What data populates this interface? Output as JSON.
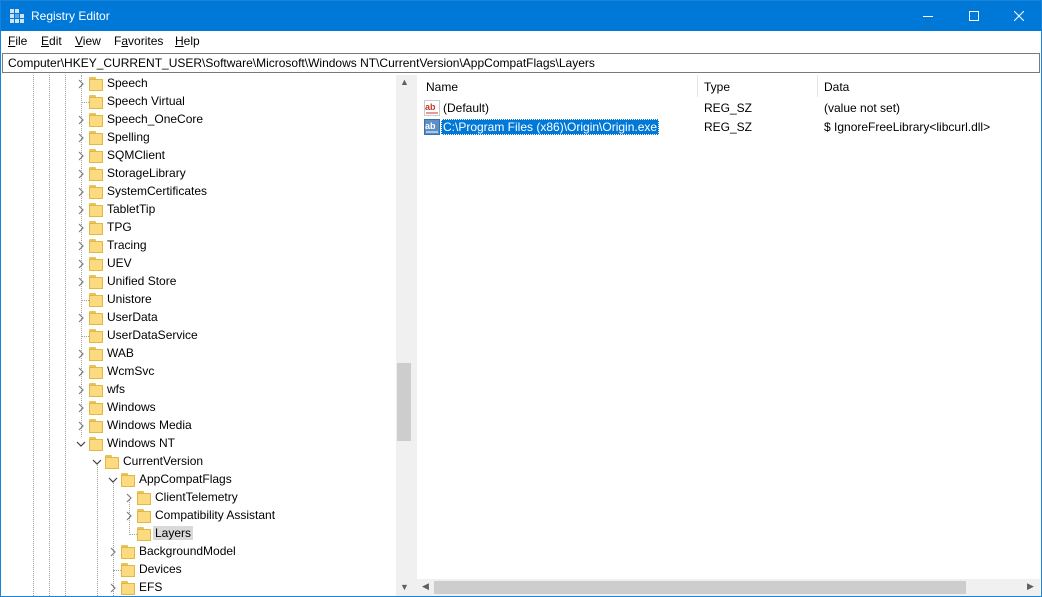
{
  "window": {
    "title": "Registry Editor"
  },
  "menu": [
    {
      "prefix": "",
      "accel": "F",
      "rest": "ile"
    },
    {
      "prefix": "",
      "accel": "E",
      "rest": "dit"
    },
    {
      "prefix": "",
      "accel": "V",
      "rest": "iew"
    },
    {
      "prefix": "F",
      "accel": "a",
      "rest": "vorites"
    },
    {
      "prefix": "",
      "accel": "H",
      "rest": "elp"
    }
  ],
  "address": {
    "path": "Computer\\HKEY_CURRENT_USER\\Software\\Microsoft\\Windows NT\\CurrentVersion\\AppCompatFlags\\Layers"
  },
  "tree": {
    "items": [
      {
        "label": "Speech",
        "expander": "collapsed",
        "depth": 0
      },
      {
        "label": "Speech Virtual",
        "expander": "none",
        "depth": 0
      },
      {
        "label": "Speech_OneCore",
        "expander": "collapsed",
        "depth": 0
      },
      {
        "label": "Spelling",
        "expander": "collapsed",
        "depth": 0
      },
      {
        "label": "SQMClient",
        "expander": "collapsed",
        "depth": 0
      },
      {
        "label": "StorageLibrary",
        "expander": "collapsed",
        "depth": 0
      },
      {
        "label": "SystemCertificates",
        "expander": "collapsed",
        "depth": 0
      },
      {
        "label": "TabletTip",
        "expander": "collapsed",
        "depth": 0
      },
      {
        "label": "TPG",
        "expander": "collapsed",
        "depth": 0
      },
      {
        "label": "Tracing",
        "expander": "collapsed",
        "depth": 0
      },
      {
        "label": "UEV",
        "expander": "collapsed",
        "depth": 0
      },
      {
        "label": "Unified Store",
        "expander": "collapsed",
        "depth": 0
      },
      {
        "label": "Unistore",
        "expander": "none",
        "depth": 0
      },
      {
        "label": "UserData",
        "expander": "collapsed",
        "depth": 0
      },
      {
        "label": "UserDataService",
        "expander": "none",
        "depth": 0
      },
      {
        "label": "WAB",
        "expander": "collapsed",
        "depth": 0
      },
      {
        "label": "WcmSvc",
        "expander": "collapsed",
        "depth": 0
      },
      {
        "label": "wfs",
        "expander": "collapsed",
        "depth": 0
      },
      {
        "label": "Windows",
        "expander": "collapsed",
        "depth": 0
      },
      {
        "label": "Windows Media",
        "expander": "collapsed",
        "depth": 0
      },
      {
        "label": "Windows NT",
        "expander": "expanded",
        "depth": 0
      },
      {
        "label": "CurrentVersion",
        "expander": "expanded",
        "depth": 1
      },
      {
        "label": "AppCompatFlags",
        "expander": "expanded",
        "depth": 2
      },
      {
        "label": "ClientTelemetry",
        "expander": "collapsed",
        "depth": 3
      },
      {
        "label": "Compatibility Assistant",
        "expander": "collapsed",
        "depth": 3
      },
      {
        "label": "Layers",
        "expander": "none",
        "depth": 3,
        "selected": true
      },
      {
        "label": "BackgroundModel",
        "expander": "collapsed",
        "depth": 2
      },
      {
        "label": "Devices",
        "expander": "none",
        "depth": 2
      },
      {
        "label": "EFS",
        "expander": "collapsed",
        "depth": 2
      }
    ]
  },
  "list": {
    "columns": {
      "name": "Name",
      "type": "Type",
      "data": "Data"
    },
    "rows": [
      {
        "name": "(Default)",
        "type": "REG_SZ",
        "data": "(value not set)",
        "selected": false
      },
      {
        "name": "C:\\Program Files (x86)\\Origin\\Origin.exe",
        "type": "REG_SZ",
        "data": "$ IgnoreFreeLibrary<libcurl.dll>",
        "selected": true
      }
    ]
  },
  "icons": {
    "app": "registry-editor-icon",
    "folder": "folder-icon",
    "string_value": "string-value-icon"
  },
  "colors": {
    "titlebar": "#0078d7",
    "selection": "#0078d7",
    "tree_selection": "#d9d9d9",
    "folder": "#fcda80"
  }
}
